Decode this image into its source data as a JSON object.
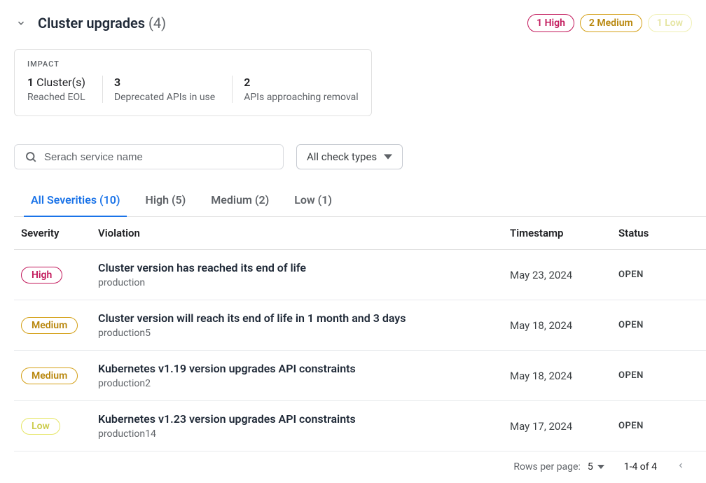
{
  "header": {
    "title": "Cluster upgrades",
    "count": "(4)",
    "badges": [
      {
        "label": "1 High",
        "class": "badge-high"
      },
      {
        "label": "2 Medium",
        "class": "badge-medium"
      },
      {
        "label": "1 Low",
        "class": "badge-low"
      }
    ]
  },
  "impact": {
    "label": "IMPACT",
    "stats": [
      {
        "value_strong": "1",
        "value_rest": " Cluster(s)",
        "desc": "Reached EOL"
      },
      {
        "value_strong": "3",
        "value_rest": "",
        "desc": "Deprecated APIs in use"
      },
      {
        "value_strong": "2",
        "value_rest": "",
        "desc": "APIs approaching removal"
      }
    ]
  },
  "search": {
    "placeholder": "Serach service name"
  },
  "dropdown": {
    "label": "All check types"
  },
  "tabs": [
    {
      "label": "All Severities (10)",
      "active": true
    },
    {
      "label": "High (5)",
      "active": false
    },
    {
      "label": "Medium (2)",
      "active": false
    },
    {
      "label": "Low (1)",
      "active": false
    }
  ],
  "columns": {
    "severity": "Severity",
    "violation": "Violation",
    "timestamp": "Timestamp",
    "status": "Status"
  },
  "rows": [
    {
      "severity": "High",
      "sevClass": "sev-high",
      "title": "Cluster version has reached its end of life",
      "sub": "production",
      "timestamp": "May 23, 2024",
      "status": "OPEN"
    },
    {
      "severity": "Medium",
      "sevClass": "sev-medium",
      "title": "Cluster version will reach its end of life in 1 month and 3 days",
      "sub": "production5",
      "timestamp": "May 18, 2024",
      "status": "OPEN"
    },
    {
      "severity": "Medium",
      "sevClass": "sev-medium",
      "title": "Kubernetes v1.19 version upgrades API constraints",
      "sub": "production2",
      "timestamp": "May 18, 2024",
      "status": "OPEN"
    },
    {
      "severity": "Low",
      "sevClass": "sev-low",
      "title": "Kubernetes v1.23 version upgrades API constraints",
      "sub": "production14",
      "timestamp": "May 17, 2024",
      "status": "OPEN"
    }
  ],
  "pagination": {
    "rows_label": "Rows per page:",
    "rows_value": "5",
    "info": "1-4 of 4"
  }
}
